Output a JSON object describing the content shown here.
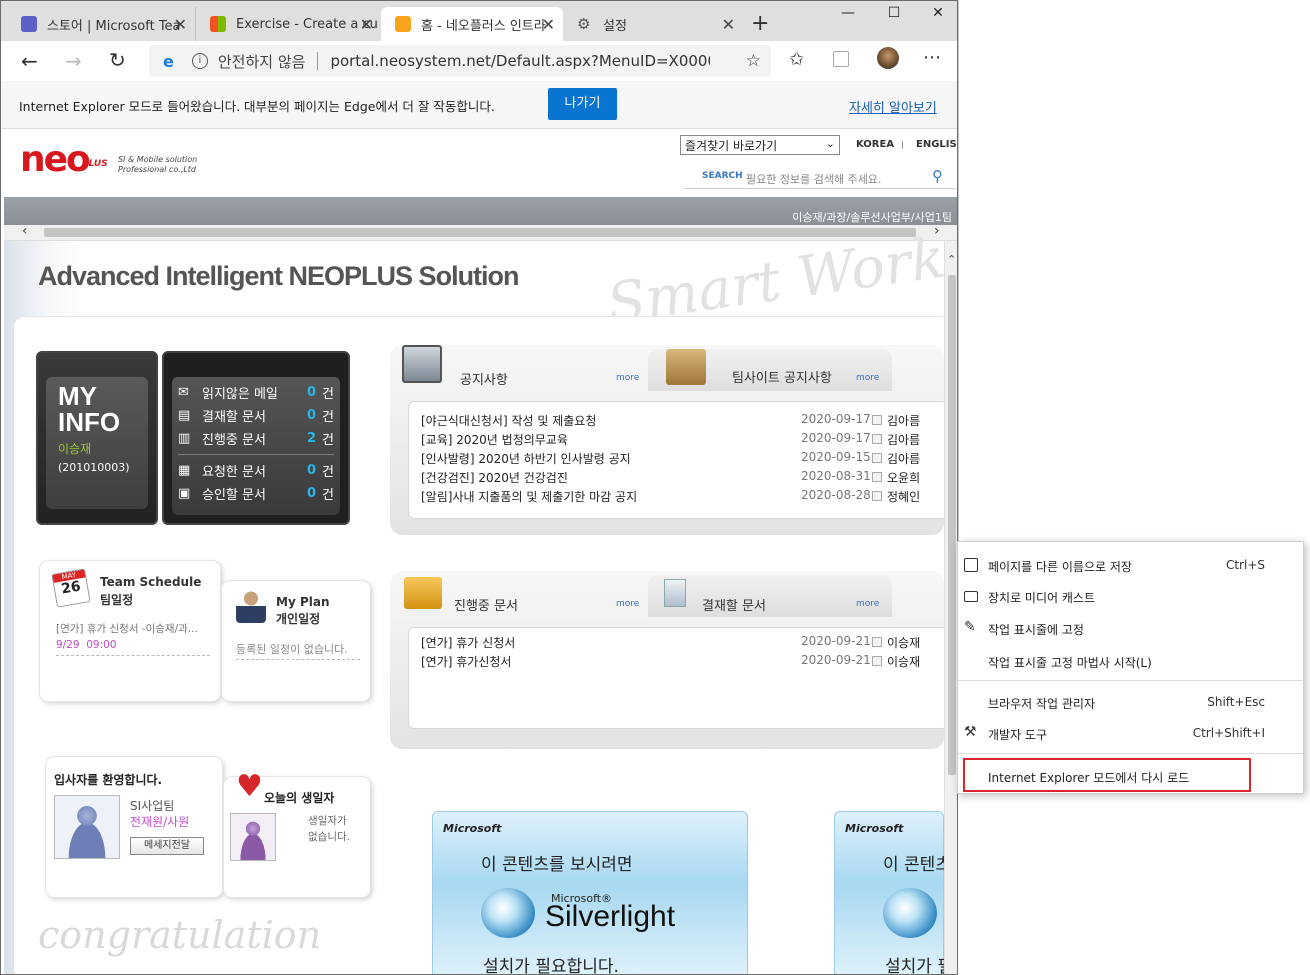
{
  "browser": {
    "tabs": [
      {
        "title": "스토어 | Microsoft Teams",
        "short": "스토어 | Microsoft Tea"
      },
      {
        "title": "Exercise - Create a custom",
        "short": "Exercise - Create a cu"
      },
      {
        "title": "홈 - 네오플러스 인트라넷",
        "short": "홈 - 네오플러스 인트라"
      },
      {
        "title": "설정",
        "short": "설정"
      }
    ],
    "new_tab": "+",
    "window_controls": {
      "minimize": "—",
      "maximize": "☐",
      "close": "✕"
    },
    "address": {
      "security": "안전하지 않음",
      "url": "portal.neosystem.net/Default.aspx?MenuID=X0000..."
    },
    "infobar": {
      "message": "Internet Explorer 모드로 들어왔습니다. 대부분의 페이지는 Edge에서 더 잘 작동합니다.",
      "button": "나가기",
      "link": "자세히 알아보기"
    }
  },
  "site": {
    "logo_text": "neo",
    "logo_plus": "PLUS",
    "tagline1": "SI & Mobile solution",
    "tagline2": "Professional co.,Ltd",
    "favorites_select": "즐겨찾기 바로가기",
    "lang_korea": "KOREA",
    "lang_english": "ENGLISH",
    "search_label": "SEARCH",
    "search_placeholder": "필요한 정보를 검색해 주세요.",
    "user_info": "이승재/과장/솔루션사업부/사업1팀",
    "hero_title": "Advanced Intelligent NEOPLUS Solution",
    "hero_script": "Smart Work",
    "myinfo": {
      "title1": "MY",
      "title2": "INFO",
      "name": "이승재",
      "id": "(201010003)",
      "items": [
        {
          "label": "읽지않은 메일",
          "count": "0",
          "unit": "건"
        },
        {
          "label": "결재할 문서",
          "count": "0",
          "unit": "건"
        },
        {
          "label": "진행중 문서",
          "count": "2",
          "unit": "건"
        },
        {
          "label": "요청한 문서",
          "count": "0",
          "unit": "건"
        },
        {
          "label": "승인할 문서",
          "count": "0",
          "unit": "건"
        }
      ]
    },
    "notice": {
      "tab1": "공지사항",
      "tab2": "팀사이트 공지사항",
      "more": "more",
      "rows": [
        {
          "title": "[야근식대신청서] 작성 및 제출요청",
          "date": "2020-09-17",
          "writer": "김아름"
        },
        {
          "title": "[교육] 2020년 법정의무교육",
          "date": "2020-09-17",
          "writer": "김아름"
        },
        {
          "title": "[인사발령] 2020년 하반기 인사발령 공지",
          "date": "2020-09-15",
          "writer": "김아름"
        },
        {
          "title": "[건강검진] 2020년 건강검진",
          "date": "2020-08-31",
          "writer": "오윤희"
        },
        {
          "title": "[알림]사내 지출품의 및 제출기한 마감 공지",
          "date": "2020-08-28",
          "writer": "정혜인"
        }
      ]
    },
    "docs": {
      "tab1": "진행중 문서",
      "tab2": "결재할 문서",
      "more": "more",
      "rows": [
        {
          "title": "[연가] 휴가 신청서",
          "date": "2020-09-21",
          "writer": "이승재"
        },
        {
          "title": "[연가] 휴가신청서",
          "date": "2020-09-21",
          "writer": "이승재"
        }
      ]
    },
    "team_schedule": {
      "title": "Team Schedule",
      "subtitle": "팀일정",
      "calendar_month": "MAY",
      "calendar_day": "26",
      "item": "[연가] 휴가 신청서 -이승재/과...",
      "when": "9/29  09:00"
    },
    "my_plan": {
      "title": "My Plan",
      "subtitle": "개인일정",
      "empty": "등록된 일정이 없습니다."
    },
    "welcome": {
      "title": "입사자를 환영합니다.",
      "team": "SI사업팀",
      "person": "전재원/사원",
      "button": "메세지전달",
      "script": "congratulation"
    },
    "birthday": {
      "title": "오늘의 생일자",
      "empty": "생일자가 없습니다."
    },
    "silverlight": {
      "ms1": "Microsoft",
      "line1": "이 콘텐츠를 보시려면",
      "brand_small": "Microsoft®",
      "brand": "Silverlight",
      "line2": "설치가 필요합니다.",
      "ms2": "Microsoft",
      "line1b": "이 콘텐츠",
      "line2b": "설치가 필"
    }
  },
  "context_menu": {
    "items": [
      {
        "label": "페이지를 다른 이름으로 저장",
        "shortcut": "Ctrl+S"
      },
      {
        "label": "장치로 미디어 캐스트",
        "shortcut": ""
      },
      {
        "label": "작업 표시줄에 고정",
        "shortcut": ""
      },
      {
        "label": "작업 표시줄 고정 마법사 시작(L)",
        "shortcut": ""
      },
      {
        "label": "브라우저 작업 관리자",
        "shortcut": "Shift+Esc"
      },
      {
        "label": "개발자 도구",
        "shortcut": "Ctrl+Shift+I"
      },
      {
        "label": "Internet Explorer 모드에서 다시 로드",
        "shortcut": ""
      }
    ]
  }
}
